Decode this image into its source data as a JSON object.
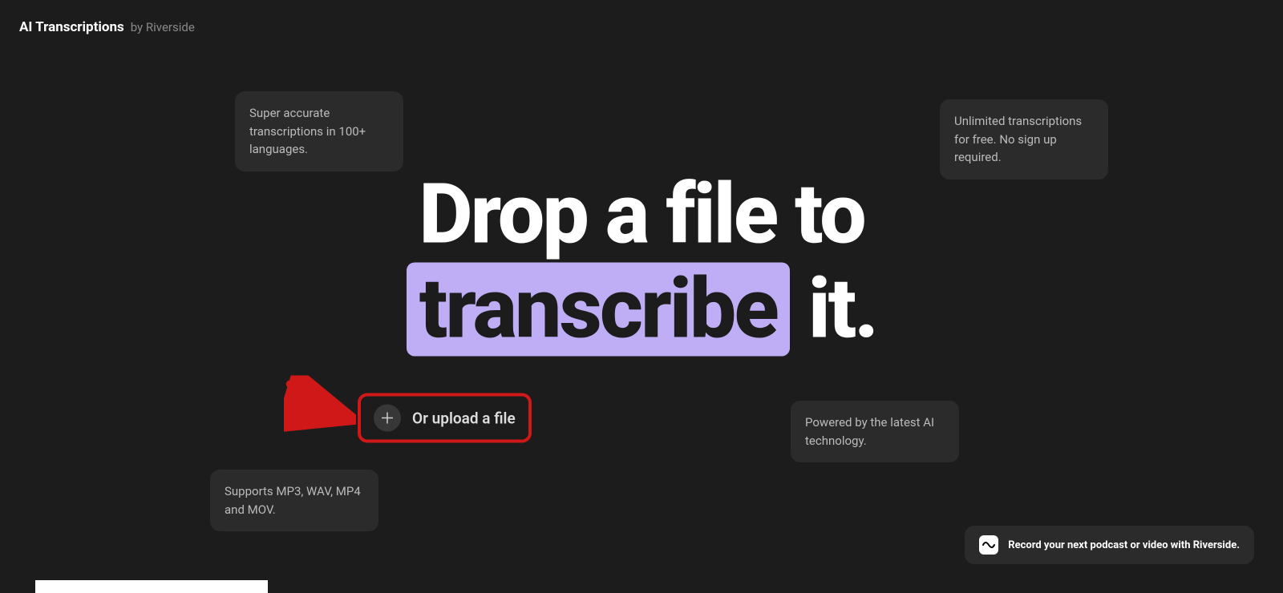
{
  "header": {
    "title": "AI Transcriptions",
    "byline": "by Riverside"
  },
  "headline": {
    "line1_prefix": "Drop a file to",
    "highlight": "transcribe",
    "line2_suffix": " it."
  },
  "upload": {
    "button_label": "Or upload a file",
    "plus_icon": "plus-icon"
  },
  "callouts": {
    "top_left": "Super accurate transcriptions in 100+ languages.",
    "top_right": "Unlimited transcriptions for free. No sign up required.",
    "right": "Powered by the latest AI technology.",
    "bottom_left": "Supports MP3, WAV, MP4 and MOV."
  },
  "cta": {
    "text": "Record your next podcast or video with Riverside.",
    "icon": "wave-icon"
  },
  "annotation": {
    "arrow_color": "#d01818",
    "highlight_color": "#d01818"
  }
}
